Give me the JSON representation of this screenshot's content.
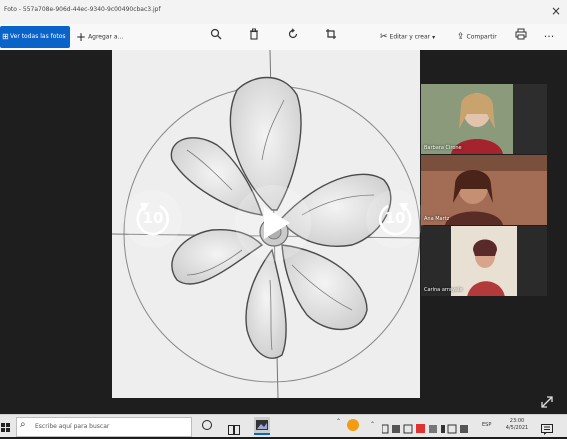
{
  "window": {
    "title": "Foto - 557a708e-906d-44ec-9340-9c00490cbac3.jpf",
    "close": "×"
  },
  "toolbar": {
    "see_all": "Ver todas las fotos",
    "see_all_icon": "⊞",
    "add_to": "Agregar a...",
    "edit_create": "Editar y crear",
    "share": "Compartir",
    "more": "···"
  },
  "participants": [
    {
      "name": "Barbara Cirone"
    },
    {
      "name": "Ana Martz"
    },
    {
      "name": "Carina arrayaie"
    }
  ],
  "player": {
    "rewind_seconds": "10",
    "forward_seconds": "10"
  },
  "taskbar": {
    "search_placeholder": "Escribe aquí para buscar",
    "lang": "ESP",
    "time": "23:00",
    "date": "4/5/2021"
  },
  "colors": {
    "accent": "#0a63c9",
    "background": "#1e1e1e"
  }
}
